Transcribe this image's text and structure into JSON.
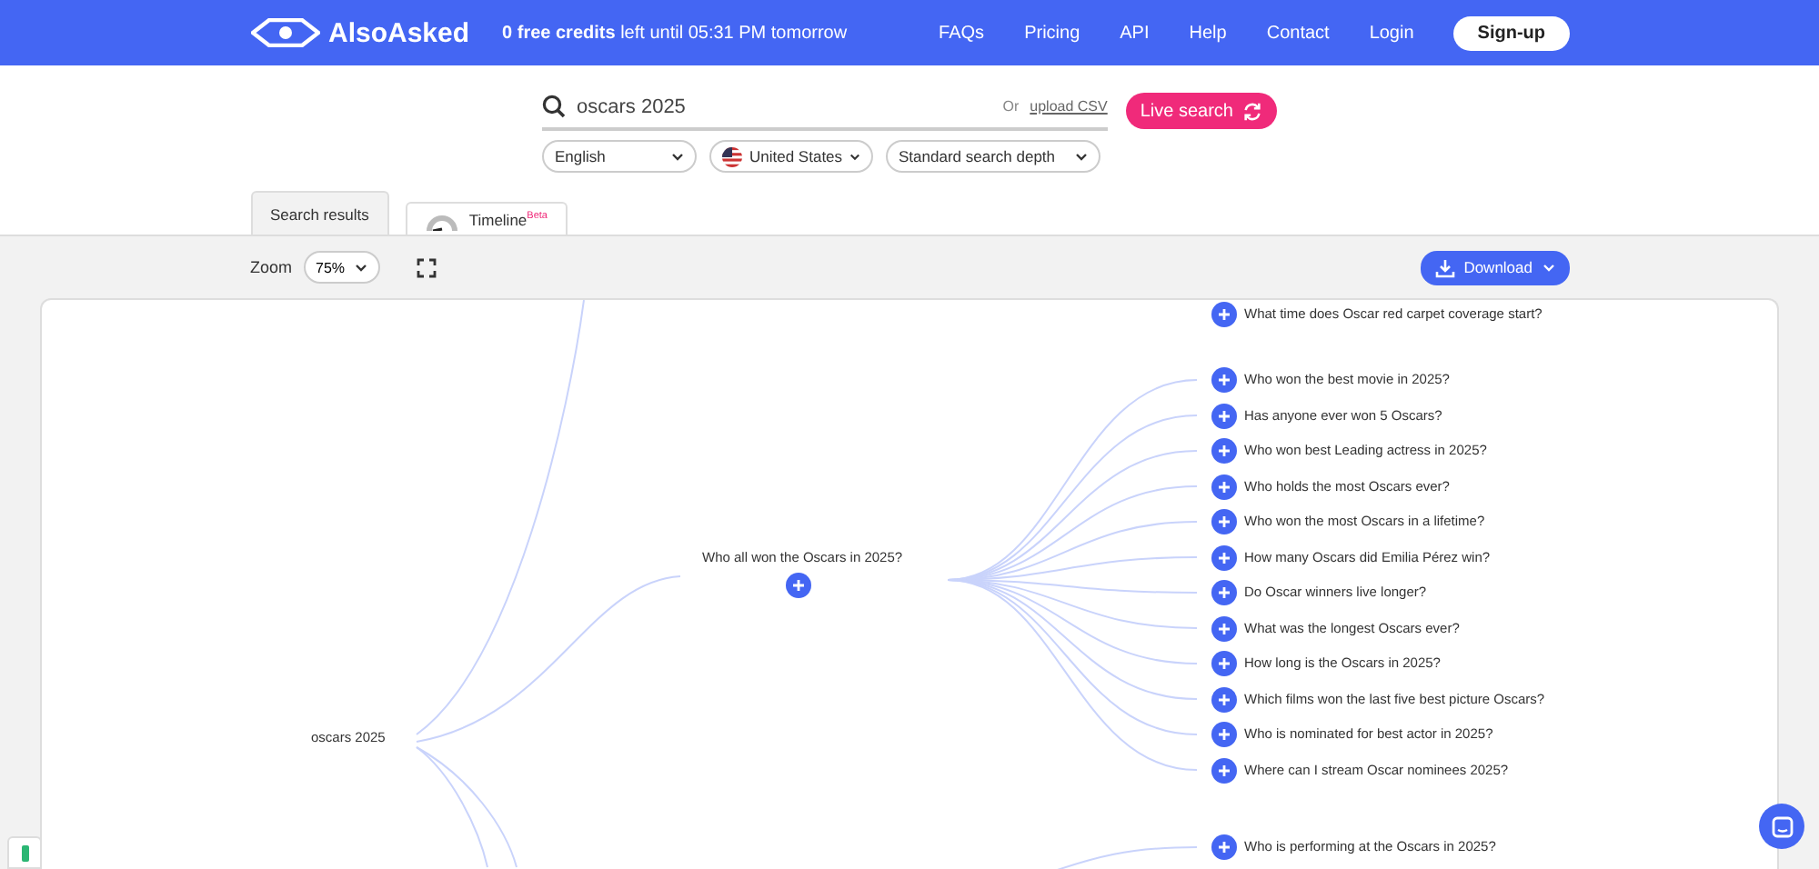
{
  "header": {
    "logo_text": "AlsoAsked",
    "credits": "**0 free credits** left until 05:31 PM tomorrow",
    "nav": [
      "FAQs",
      "Pricing",
      "API",
      "Help",
      "Contact",
      "Login"
    ],
    "signup": "Sign-up"
  },
  "search": {
    "query": "oscars 2025",
    "upload_prefix": "Or",
    "upload_link": "upload CSV",
    "button": "Live search"
  },
  "filters": [
    {
      "kind": "select",
      "label": "English"
    },
    {
      "kind": "country",
      "label": "United States"
    },
    {
      "kind": "select",
      "label": "Standard search depth"
    }
  ],
  "tabs": [
    {
      "label": "Search results",
      "selected": true
    },
    {
      "label": "Timeline",
      "badge": "Beta",
      "selected": false
    }
  ],
  "toolbar": {
    "zoom_label": "Zoom",
    "zoom_value": "75%",
    "download": "Download"
  },
  "mindmap": {
    "root": "oscars 2025",
    "above_question": "What time does Oscar red carpet coverage start?",
    "branch": {
      "label": "Who all won the Oscars in 2025?",
      "children": [
        "Who won the best movie in 2025?",
        "Has anyone ever won 5 Oscars?",
        "Who won best Leading actress in 2025?",
        "Who holds the most Oscars ever?",
        "Who won the most Oscars in a lifetime?",
        "How many Oscars did Emilia Pérez win?",
        "Do Oscar winners live longer?",
        "What was the longest Oscars ever?",
        "How long is the Oscars in 2025?",
        "Which films won the last five best picture Oscars?",
        "Who is nominated for best actor in 2025?",
        "Where can I stream Oscar nominees 2025?"
      ]
    },
    "below_question": "Who is performing at the Oscars in 2025?"
  }
}
